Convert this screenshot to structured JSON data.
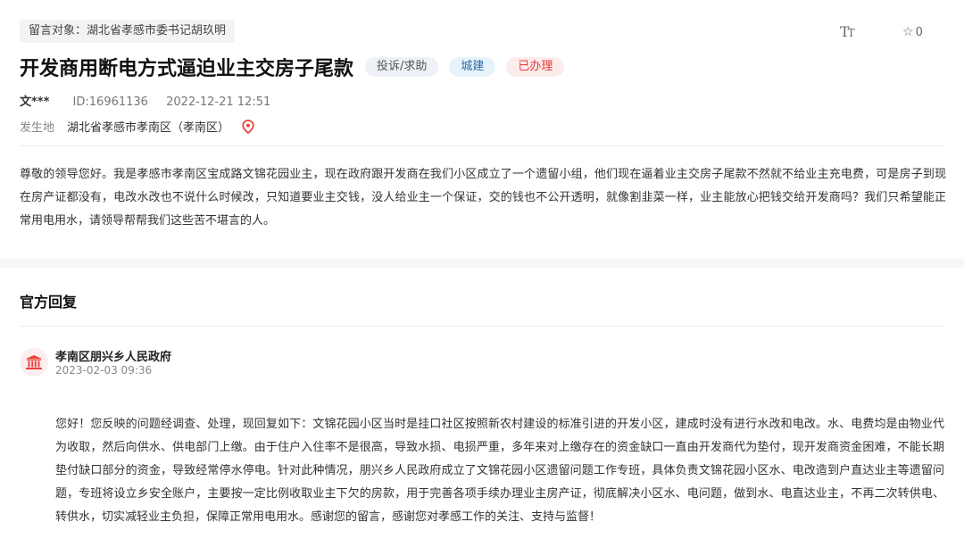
{
  "header": {
    "target_tag": "留言对象：湖北省孝感市委书记胡玖明",
    "favorite_count": "0"
  },
  "post": {
    "title": "开发商用断电方式逼迫业主交房子尾款",
    "badges": {
      "type": "投诉/求助",
      "category": "城建",
      "status": "已办理"
    },
    "author": "文***",
    "id": "ID:16961136",
    "datetime": "2022-12-21 12:51",
    "place_label": "发生地",
    "place_value": "湖北省孝感市孝南区（孝南区）",
    "content": "尊敬的领导您好。我是孝感市孝南区宝成路文锦花园业主，现在政府跟开发商在我们小区成立了一个遗留小组，他们现在逼着业主交房子尾款不然就不给业主充电费，可是房子到现在房产证都没有，电改水改也不说什么时候改，只知道要业主交钱，没人给业主一个保证，交的钱也不公开透明，就像割韭菜一样，业主能放心把钱交给开发商吗？我们只希望能正常用电用水，请领导帮帮我们这些苦不堪言的人。"
  },
  "reply": {
    "section_title": "官方回复",
    "org_name": "孝南区朋兴乡人民政府",
    "date": "2023-02-03 09:36",
    "content": "您好！您反映的问题经调查、处理，现回复如下：文锦花园小区当时是挂口社区按照新农村建设的标准引进的开发小区，建成时没有进行水改和电改。水、电费均是由物业代为收取，然后向供水、供电部门上缴。由于住户入住率不是很高，导致水损、电损严重，多年来对上缴存在的资金缺口一直由开发商代为垫付，现开发商资金困难，不能长期垫付缺口部分的资金，导致经常停水停电。针对此种情况，朋兴乡人民政府成立了文锦花园小区遗留问题工作专班，具体负责文锦花园小区水、电改造到户直达业主等遗留问题，专班将设立乡安全账户，主要按一定比例收取业主下欠的房款，用于完善各项手续办理业主房产证，彻底解决小区水、电问题，做到水、电直达业主，不再二次转供电、转供水，切实减轻业主负担，保障正常用电用水。感谢您的留言，感谢您对孝感工作的关注、支持与监督！"
  },
  "icons": {
    "font_size": "font-size-icon",
    "favorite": "star-icon",
    "location": "location-pin-icon",
    "org": "government-building-icon"
  },
  "colors": {
    "status_red": "#e23b3b",
    "category_blue": "#2b6aa8",
    "pin_red": "#e8453c"
  }
}
